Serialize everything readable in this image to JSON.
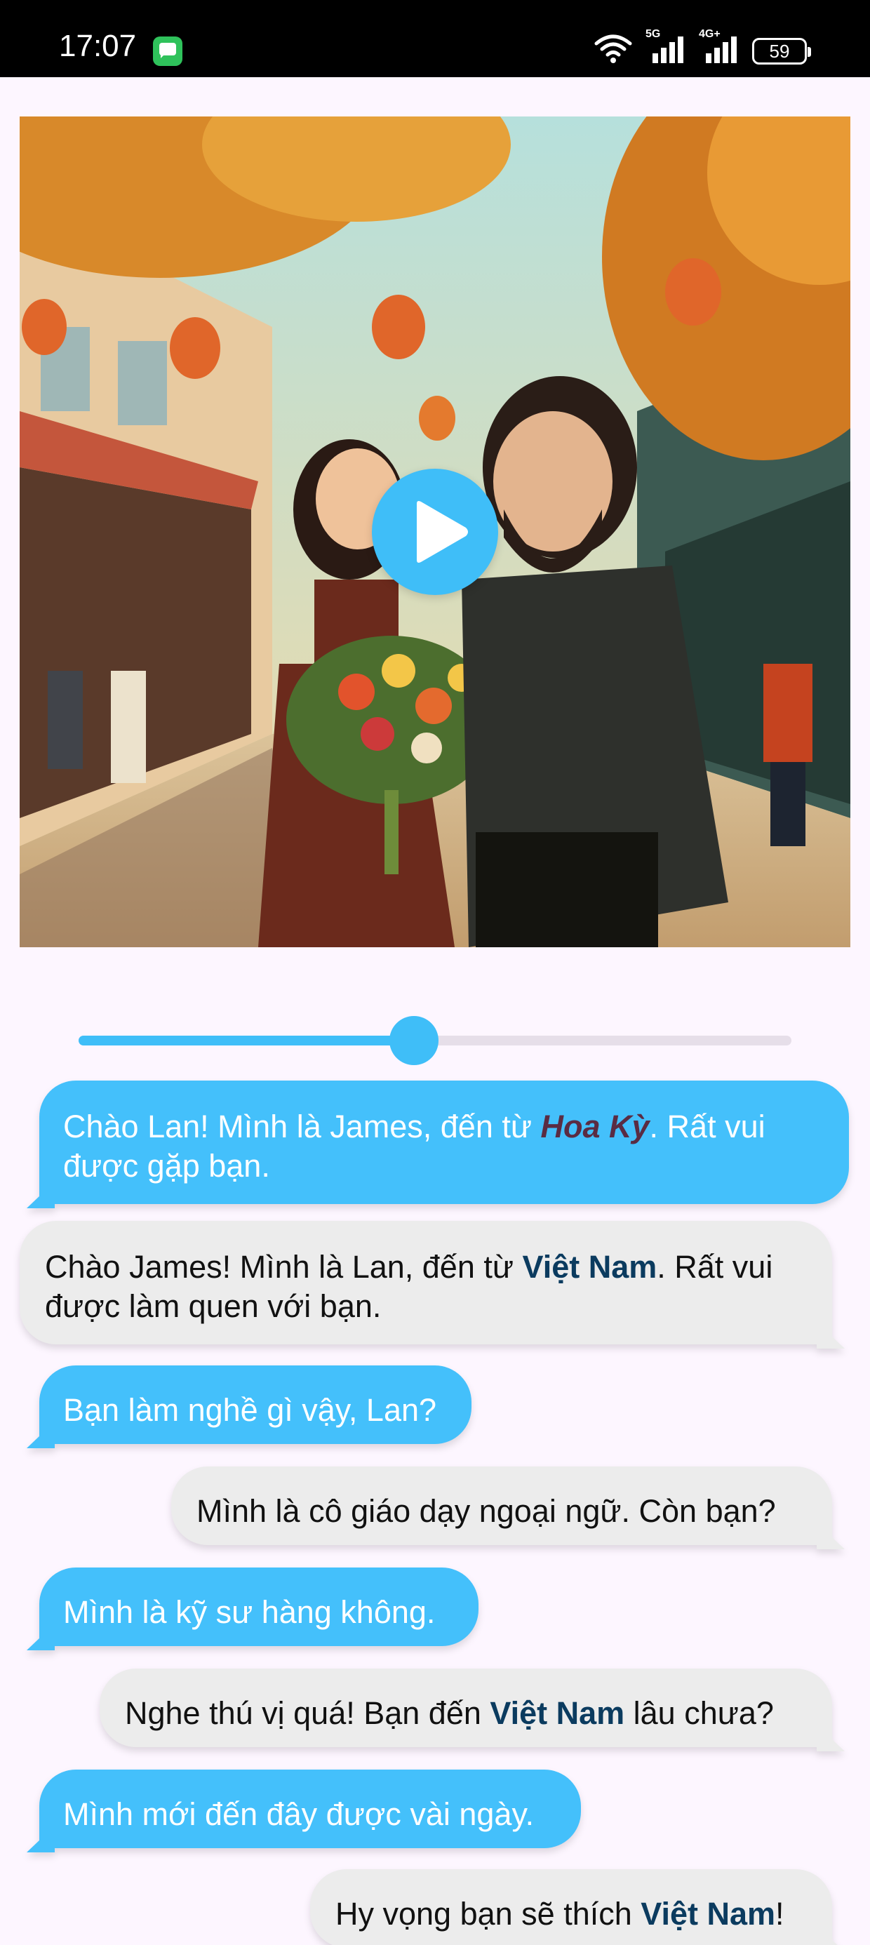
{
  "status_bar": {
    "time": "17:07",
    "signal1_label": "5G",
    "signal2_label": "4G+",
    "battery": "59",
    "icons": [
      "message-app-icon",
      "wifi-icon",
      "signal-5g-icon",
      "signal-4g-icon",
      "battery-icon"
    ]
  },
  "video": {
    "play_icon": "play-icon",
    "progress": 0.47
  },
  "colors": {
    "accent": "#44c0fb",
    "left_highlight": "#5a2c43",
    "right_highlight": "#0b3b5f",
    "right_bubble": "#ececec"
  },
  "messages": [
    {
      "side": "left",
      "text_before": "Chào Lan! Mình là James, đến từ ",
      "highlight": "Hoa Kỳ",
      "text_after": ". Rất vui được gặp bạn."
    },
    {
      "side": "right",
      "text_before": "Chào James! Mình là Lan, đến từ ",
      "highlight": "Việt Nam",
      "text_after": ". Rất vui được làm quen với bạn."
    },
    {
      "side": "left",
      "text_before": "Bạn làm nghề gì vậy, Lan?",
      "highlight": "",
      "text_after": ""
    },
    {
      "side": "right",
      "text_before": "Mình là cô giáo dạy ngoại ngữ. Còn bạn?",
      "highlight": "",
      "text_after": ""
    },
    {
      "side": "left",
      "text_before": "Mình là kỹ sư hàng không.",
      "highlight": "",
      "text_after": ""
    },
    {
      "side": "right",
      "text_before": "Nghe thú vị quá! Bạn đến ",
      "highlight": "Việt Nam",
      "text_after": " lâu chưa?"
    },
    {
      "side": "left",
      "text_before": "Mình mới đến đây được vài ngày.",
      "highlight": "",
      "text_after": ""
    },
    {
      "side": "right",
      "text_before": "Hy vọng bạn sẽ thích ",
      "highlight": "Việt Nam",
      "text_after": "!"
    }
  ]
}
